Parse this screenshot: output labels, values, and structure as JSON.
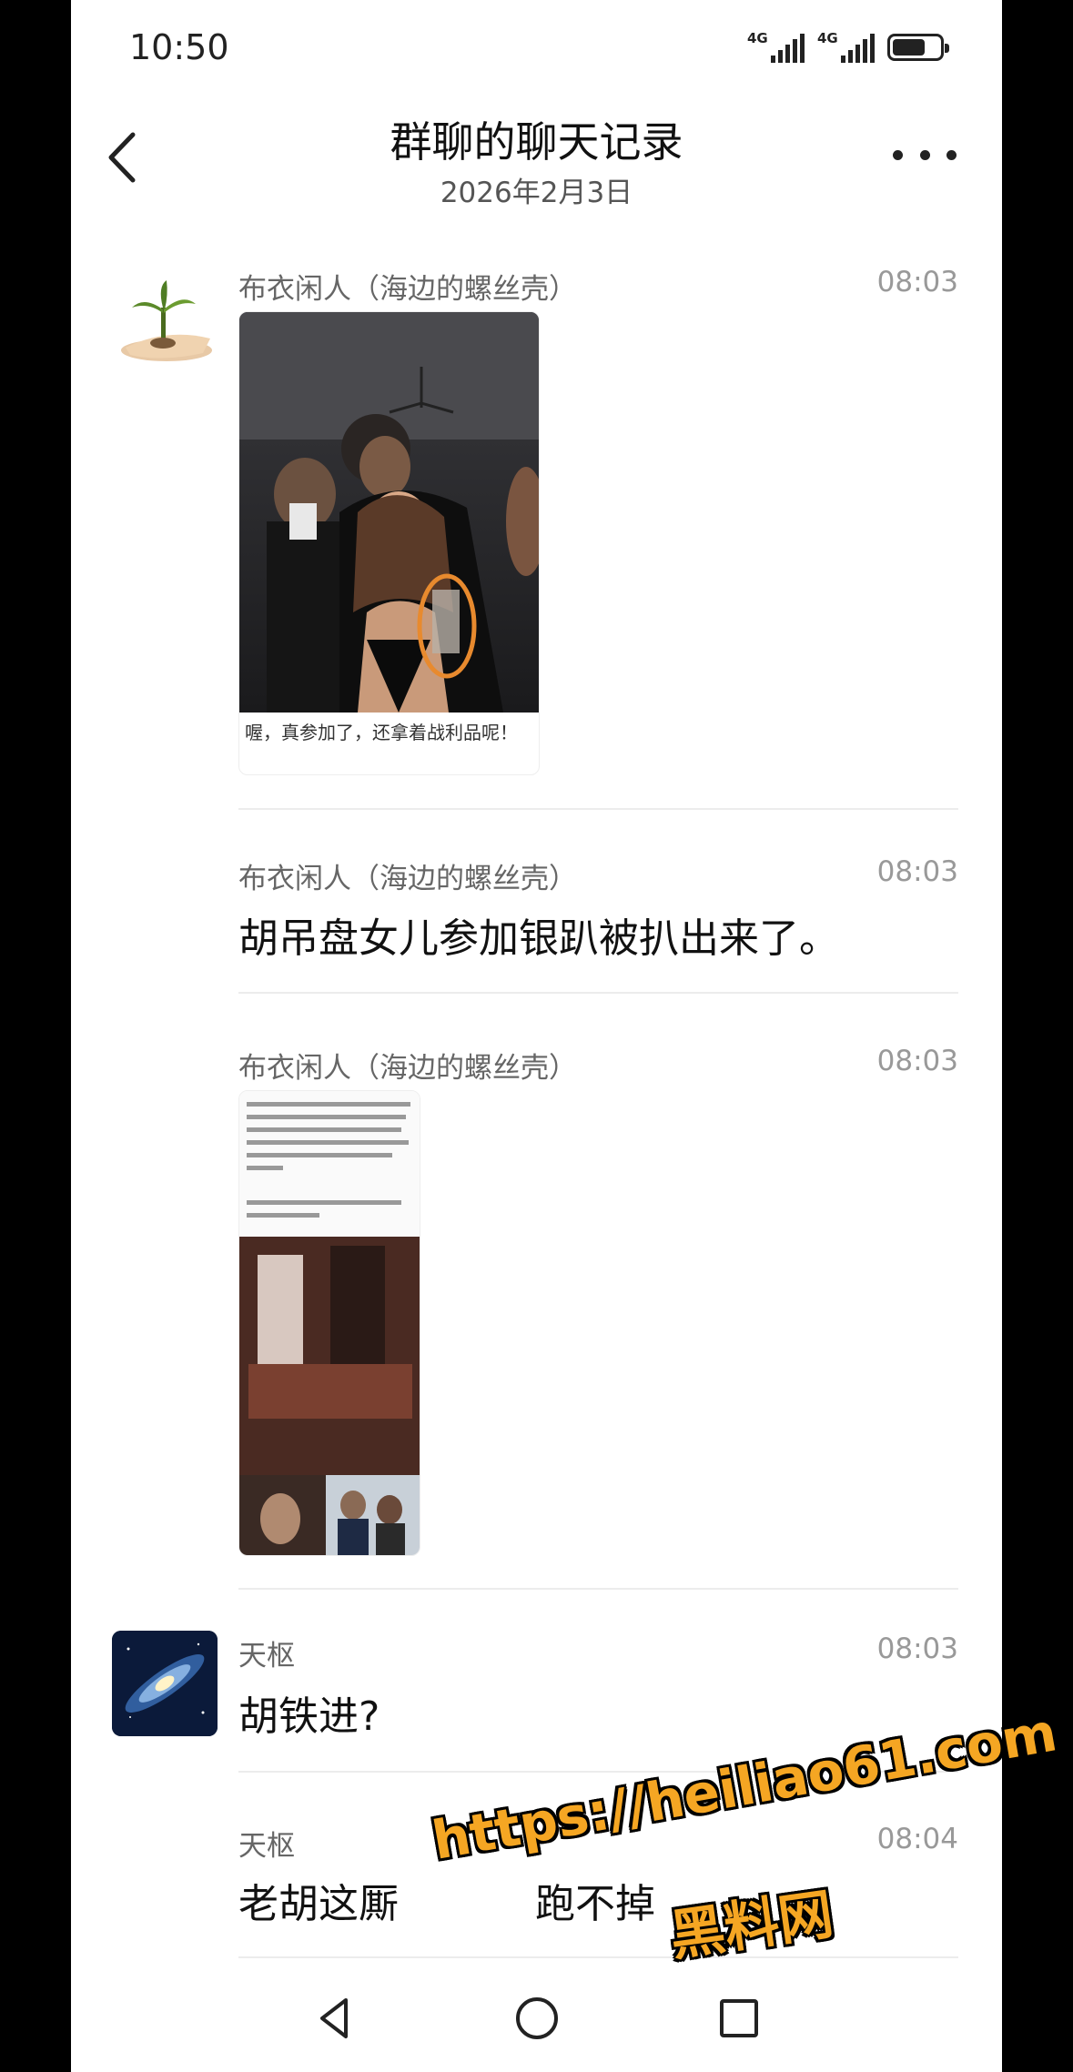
{
  "status_bar": {
    "time": "10:50",
    "network_1": "4G",
    "network_2": "4G",
    "battery_level": 0.7
  },
  "header": {
    "title": "群聊的聊天记录",
    "subtitle": "2026年2月3日",
    "back_icon": "chevron-left-icon",
    "more_icon": "more-dots-icon"
  },
  "messages": [
    {
      "sender": "布衣闲人（海边的螺丝壳）",
      "time": "08:03",
      "type": "image",
      "image_caption": "喔，真参加了，还拿着战利品呢！"
    },
    {
      "sender": "布衣闲人（海边的螺丝壳）",
      "time": "08:03",
      "type": "text",
      "text": "胡吊盘女儿参加银趴被扒出来了。"
    },
    {
      "sender": "布衣闲人（海边的螺丝壳）",
      "time": "08:03",
      "type": "image"
    },
    {
      "sender": "天枢",
      "time": "08:03",
      "type": "text",
      "text": "胡铁进?"
    },
    {
      "sender": "天枢",
      "time": "08:04",
      "type": "text",
      "text": "老胡这厮",
      "text_tail": "跑不掉"
    }
  ],
  "watermark": {
    "url": "https://heiliao61.com",
    "label": "黑料网"
  },
  "navbar": {
    "back_icon": "triangle-back-icon",
    "home_icon": "circle-home-icon",
    "recents_icon": "square-recents-icon"
  },
  "colors": {
    "watermark": "#f5a623",
    "sender_text": "#666666",
    "time_text": "#999999"
  }
}
